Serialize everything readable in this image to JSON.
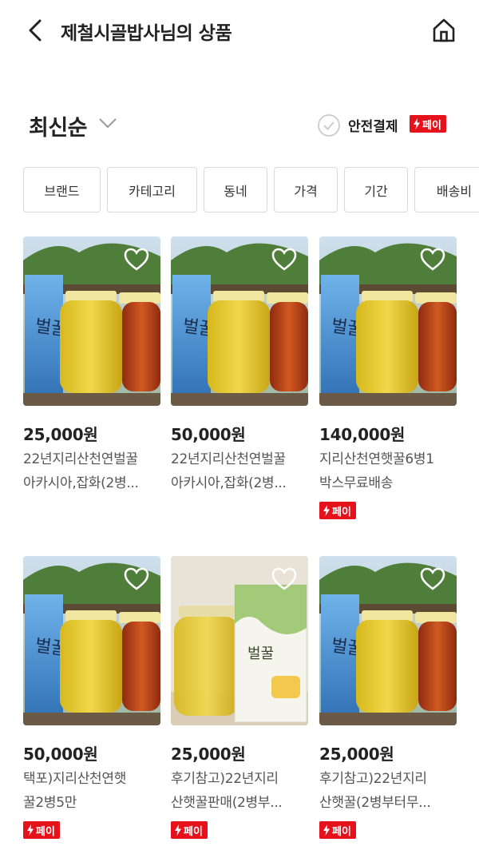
{
  "header": {
    "back_icon": "chevron-left-icon",
    "title": "제철시골밥사님의 상품",
    "home_icon": "home-icon"
  },
  "sort": {
    "label": "최신순",
    "chevron_icon": "chevron-down-icon",
    "safe_payment_label": "안전결제",
    "pay_badge_label": "페이"
  },
  "filters": [
    "브랜드",
    "카테고리",
    "동네",
    "가격",
    "기간",
    "배송비"
  ],
  "products": [
    {
      "price": "25,000원",
      "name_line1": "22년지리산천연벌꿀",
      "name_line2": "아카시아,잡화(2병...",
      "pay": false,
      "image": "three-jars-honey"
    },
    {
      "price": "50,000원",
      "name_line1": "22년지리산천연벌꿀",
      "name_line2": "아카시아,잡화(2병...",
      "pay": false,
      "image": "three-jars-honey"
    },
    {
      "price": "140,000원",
      "name_line1": "지리산천연햇꿀6병1",
      "name_line2": "박스무료배송",
      "pay": true,
      "image": "three-jars-honey"
    },
    {
      "price": "50,000원",
      "name_line1": "택포)지리산천연햇",
      "name_line2": "꿀2병5만",
      "pay": true,
      "image": "three-jars-honey"
    },
    {
      "price": "25,000원",
      "name_line1": "후기참고)22년지리",
      "name_line2": "산햇꿀판매(2병부...",
      "pay": true,
      "image": "jar-with-gift-box"
    },
    {
      "price": "25,000원",
      "name_line1": "후기참고)22년지리",
      "name_line2": "산햇꿀(2병부터무...",
      "pay": true,
      "image": "three-jars-honey"
    }
  ],
  "pay_badge_label": "페이",
  "box_label": "벌꿀",
  "colors": {
    "pay_red": "#e5121c",
    "honey_yellow": "#e8c020",
    "honey_amber": "#b5391a",
    "box_blue": "#3c7fc4"
  }
}
